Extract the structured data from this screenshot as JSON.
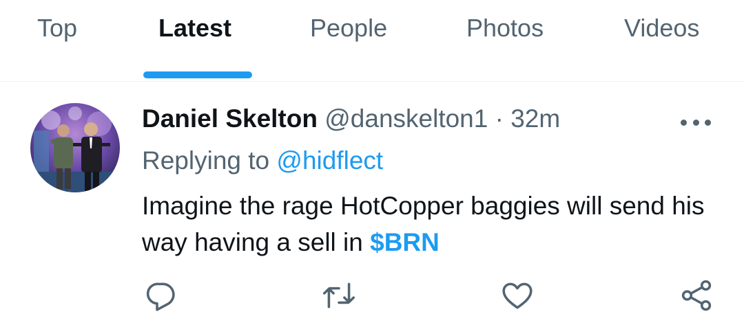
{
  "tabs": [
    {
      "label": "Top",
      "active": false
    },
    {
      "label": "Latest",
      "active": true
    },
    {
      "label": "People",
      "active": false
    },
    {
      "label": "Photos",
      "active": false
    },
    {
      "label": "Videos",
      "active": false
    }
  ],
  "tweet": {
    "author_name": "Daniel Skelton",
    "author_handle": "@danskelton1",
    "separator": "·",
    "time": "32m",
    "replying_prefix": "Replying to",
    "replying_to": "@hidflect",
    "text_before_cashtag": "Imagine the rage HotCopper baggies will send his way having a sell in ",
    "cashtag": "$BRN"
  },
  "actions": [
    {
      "icon": "reply-icon"
    },
    {
      "icon": "retweet-icon"
    },
    {
      "icon": "like-icon"
    },
    {
      "icon": "share-icon"
    }
  ],
  "colors": {
    "accent": "#1d9bf0",
    "secondary_text": "#536471",
    "primary_text": "#0f1419",
    "divider": "#eff3f4"
  }
}
